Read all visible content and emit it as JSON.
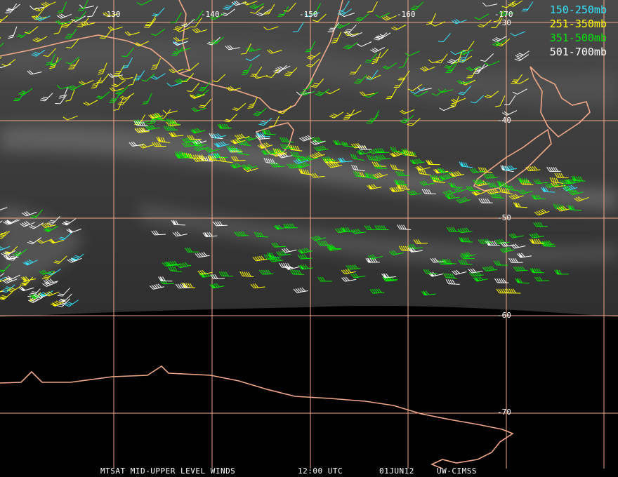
{
  "footer": {
    "product": "MTSAT MID-UPPER LEVEL WINDS",
    "time": "12:00 UTC",
    "date": "01JUN12",
    "source": "UW-CIMSS"
  },
  "legend": [
    {
      "label": "150-250mb",
      "color": "#33e6ff"
    },
    {
      "label": "251-350mb",
      "color": "#ffff00"
    },
    {
      "label": "351-500mb",
      "color": "#00e600"
    },
    {
      "label": "501-700mb",
      "color": "#ffffff"
    }
  ],
  "longitude_labels": [
    "-130",
    "-140",
    "-150",
    "-160",
    "-170"
  ],
  "latitude_labels": [
    "-30",
    "-40",
    "-50",
    "-60",
    "-70"
  ],
  "colors": {
    "grid": "#f0a888",
    "coast": "#f0a888",
    "space": "#000000"
  }
}
